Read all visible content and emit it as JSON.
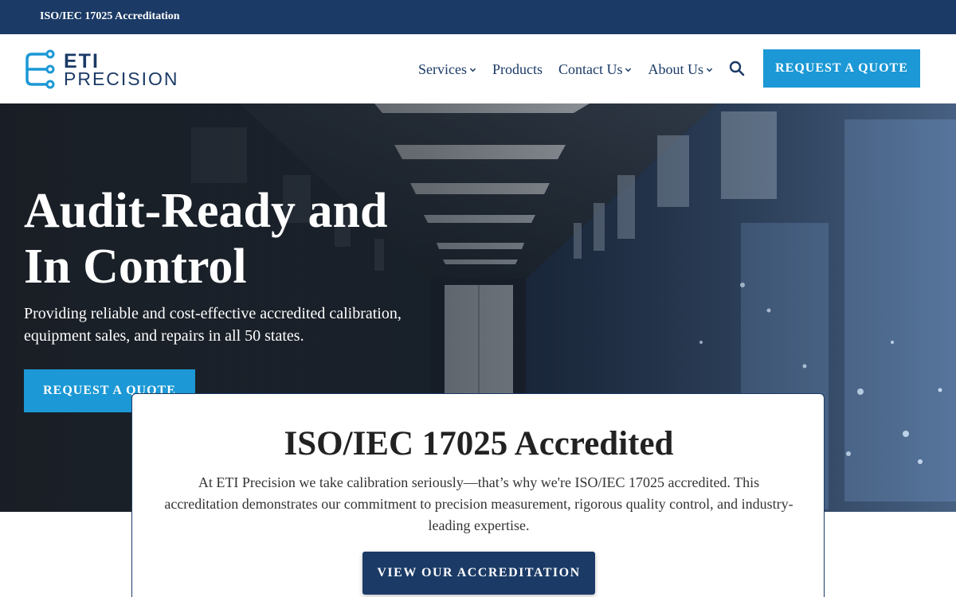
{
  "topbar": {
    "text": "ISO/IEC 17025 Accreditation"
  },
  "logo": {
    "line1": "ETI",
    "line2": "PRECISION"
  },
  "nav": {
    "items": [
      {
        "label": "Services",
        "has_dropdown": true
      },
      {
        "label": "Products",
        "has_dropdown": false
      },
      {
        "label": "Contact Us",
        "has_dropdown": true
      },
      {
        "label": "About Us",
        "has_dropdown": true
      }
    ],
    "search_icon": "search-icon",
    "cta_label": "REQUEST A QUOTE"
  },
  "hero": {
    "title_line1": "Audit-Ready and",
    "title_line2": "In Control",
    "subtitle": "Providing reliable and cost-effective accredited calibration, equipment sales, and repairs in all 50 states.",
    "cta_label": "REQUEST A QUOTE"
  },
  "accreditation_card": {
    "title": "ISO/IEC 17025 Accredited",
    "text": "At ETI Precision we take calibration seriously—that’s why we're ISO/IEC 17025 accredited. This accreditation demonstrates our commitment to precision measurement, rigorous quality control, and industry-leading expertise.",
    "button_label": "VIEW OUR ACCREDITATION"
  },
  "colors": {
    "navy": "#1b3a66",
    "accent_blue": "#1b98d5",
    "white": "#ffffff"
  }
}
